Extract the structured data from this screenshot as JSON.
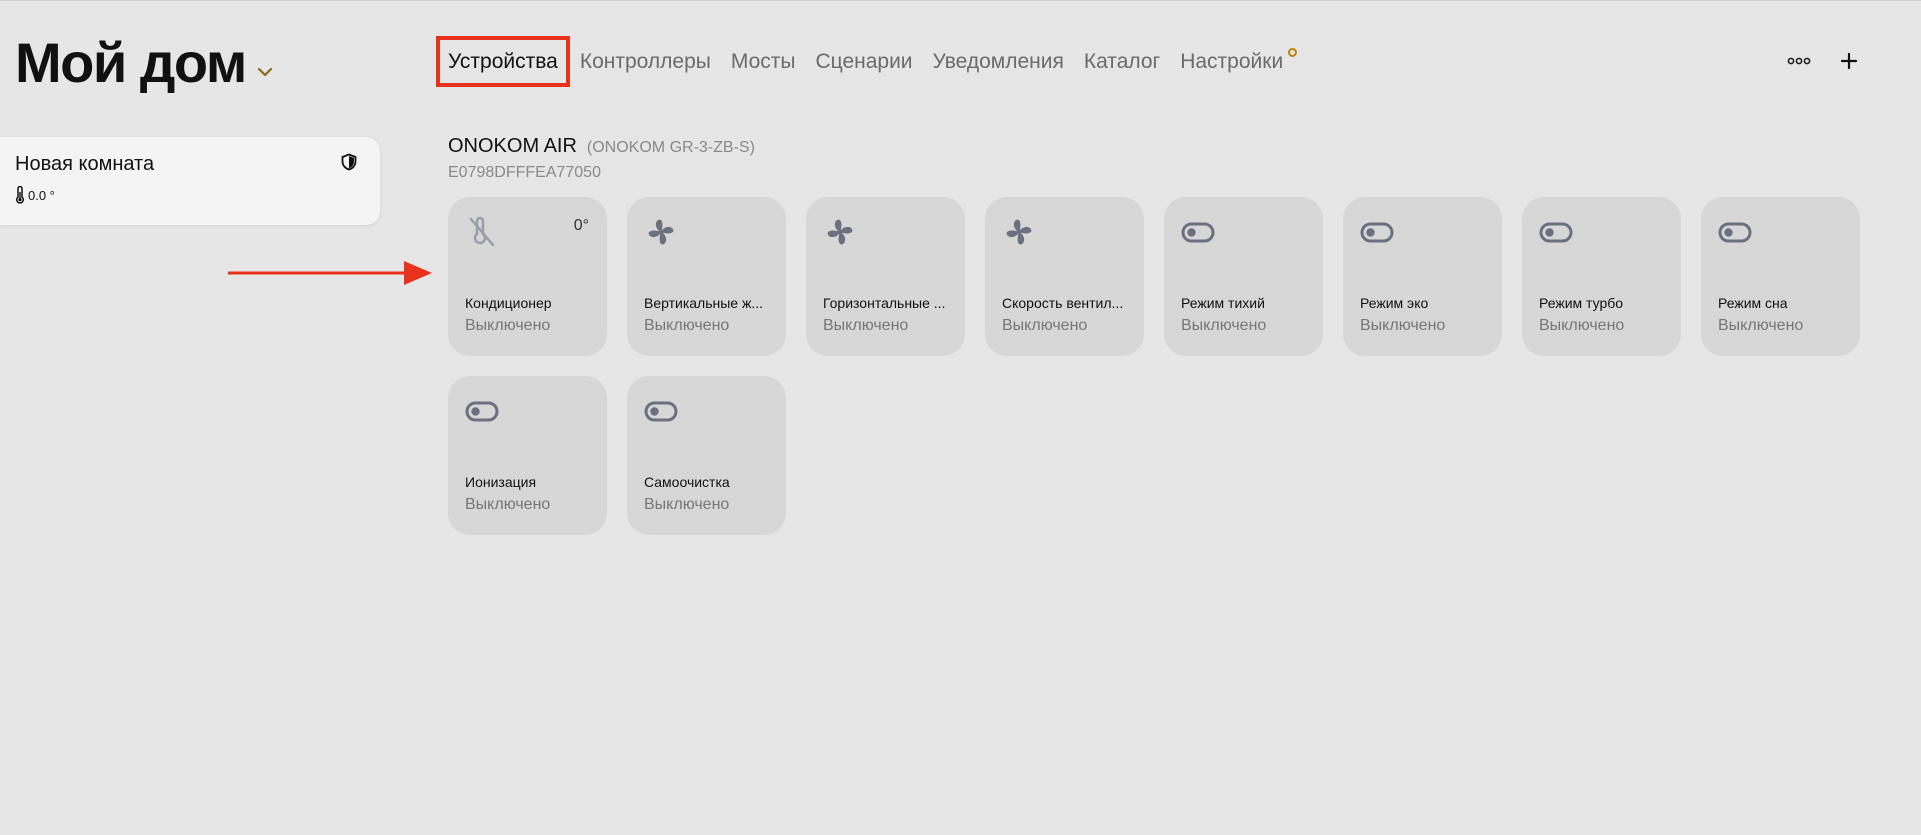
{
  "header": {
    "home_title": "Мой дом",
    "tabs": [
      {
        "label": "Устройства"
      },
      {
        "label": "Контроллеры"
      },
      {
        "label": "Мосты"
      },
      {
        "label": "Сценарии"
      },
      {
        "label": "Уведомления"
      },
      {
        "label": "Каталог"
      },
      {
        "label": "Настройки"
      }
    ],
    "active_tab": "Устройства",
    "actions": [
      "more-icon",
      "plus-icon"
    ]
  },
  "room": {
    "name": "Новая комната",
    "temperature": "0.0 °",
    "icon": "shield-icon"
  },
  "device": {
    "name": "ONOKOM AIR",
    "model": "(ONOKOM GR-3-ZB-S)",
    "id": "E0798DFFFEA77050"
  },
  "tiles": [
    {
      "label": "Кондиционер",
      "state": "Выключено",
      "value": "0°",
      "icon": "ac-off-icon"
    },
    {
      "label": "Вертикальные ж...",
      "state": "Выключено",
      "icon": "fan-icon"
    },
    {
      "label": "Горизонтальные ...",
      "state": "Выключено",
      "icon": "fan-icon"
    },
    {
      "label": "Скорость вентил...",
      "state": "Выключено",
      "icon": "fan-icon"
    },
    {
      "label": "Режим тихий",
      "state": "Выключено",
      "icon": "toggle-icon"
    },
    {
      "label": "Режим эко",
      "state": "Выключено",
      "icon": "toggle-icon"
    },
    {
      "label": "Режим турбо",
      "state": "Выключено",
      "icon": "toggle-icon"
    },
    {
      "label": "Режим сна",
      "state": "Выключено",
      "icon": "toggle-icon"
    },
    {
      "label": "Ионизация",
      "state": "Выключено",
      "icon": "toggle-icon"
    },
    {
      "label": "Самоочистка",
      "state": "Выключено",
      "icon": "toggle-icon"
    }
  ],
  "colors": {
    "background": "#e6e6e6",
    "tile": "#d7d7d7",
    "highlight": "#e8321e",
    "accent": "#b8860b",
    "icon": "#6b7080"
  }
}
